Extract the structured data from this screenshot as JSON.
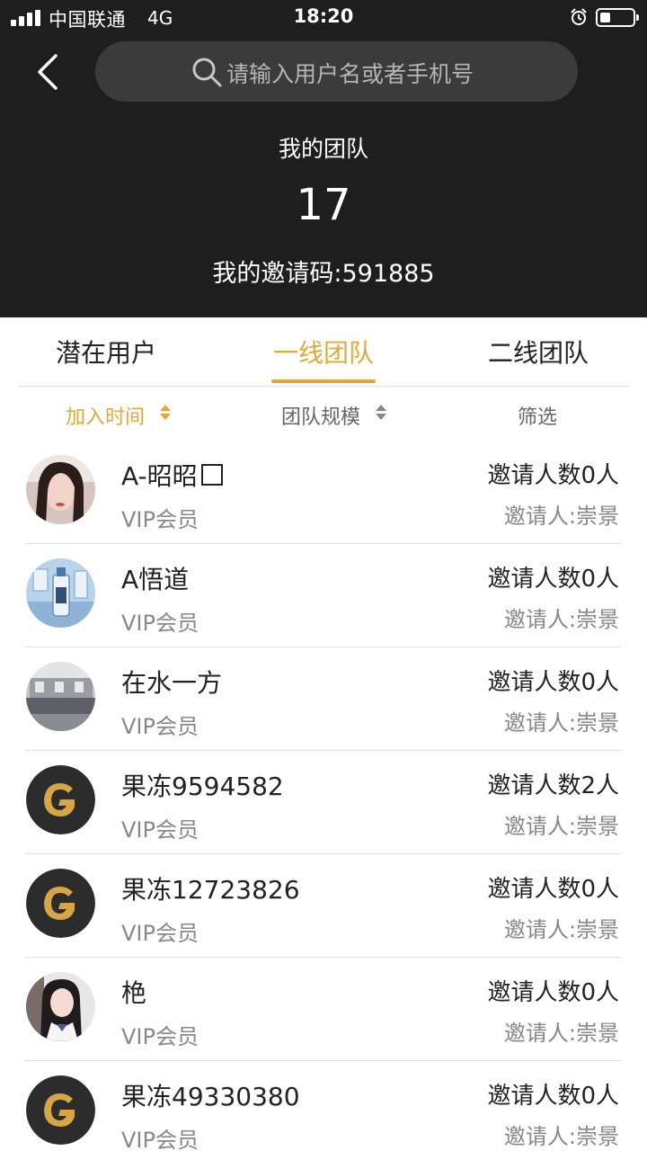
{
  "status_bar": {
    "carrier": "中国联通",
    "network": "4G",
    "time": "18:20"
  },
  "search": {
    "placeholder": "请输入用户名或者手机号"
  },
  "summary": {
    "title": "我的团队",
    "count": "17",
    "invite_code": "我的邀请码:591885"
  },
  "tabs": [
    {
      "label": "潜在用户",
      "active": false
    },
    {
      "label": "一线团队",
      "active": true
    },
    {
      "label": "二线团队",
      "active": false
    }
  ],
  "sort": [
    {
      "label": "加入时间",
      "active": true
    },
    {
      "label": "团队规模",
      "active": false
    },
    {
      "label": "筛选",
      "active": false
    }
  ],
  "colors": {
    "accent": "#e1a83a",
    "header_bg": "#1e1e1e"
  },
  "members": [
    {
      "name": "A-昭昭",
      "level": "VIP会员",
      "invites": "邀请人数0人",
      "inviter": "邀请人:崇景",
      "avatar": "photo-woman"
    },
    {
      "name": "A悟道",
      "level": "VIP会员",
      "invites": "邀请人数0人",
      "inviter": "邀请人:崇景",
      "avatar": "photo-bottle"
    },
    {
      "name": "在水一方",
      "level": "VIP会员",
      "invites": "邀请人数0人",
      "inviter": "邀请人:崇景",
      "avatar": "photo-building"
    },
    {
      "name": "果冻9594582",
      "level": "VIP会员",
      "invites": "邀请人数2人",
      "inviter": "邀请人:崇景",
      "avatar": "g-logo"
    },
    {
      "name": "果冻12723826",
      "level": "VIP会员",
      "invites": "邀请人数0人",
      "inviter": "邀请人:崇景",
      "avatar": "g-logo"
    },
    {
      "name": "栬",
      "level": "VIP会员",
      "invites": "邀请人数0人",
      "inviter": "邀请人:崇景",
      "avatar": "photo-girl"
    },
    {
      "name": "果冻49330380",
      "level": "VIP会员",
      "invites": "邀请人数0人",
      "inviter": "邀请人:崇景",
      "avatar": "g-logo"
    }
  ]
}
